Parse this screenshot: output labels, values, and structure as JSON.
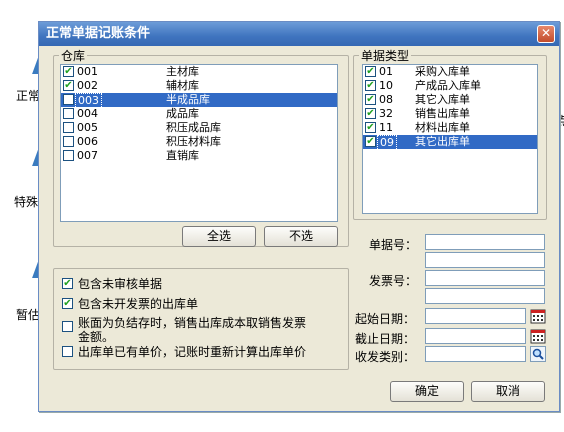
{
  "background": {
    "text1": "正常",
    "text2": "特殊",
    "text3": "暂估",
    "text4": "点"
  },
  "dialog": {
    "title": "正常单据记账条件",
    "close_glyph": "✕"
  },
  "warehouse": {
    "group_title": "仓库",
    "items": [
      {
        "code": "001",
        "name": "主材库",
        "checked": true,
        "selected": false
      },
      {
        "code": "002",
        "name": "辅材库",
        "checked": true,
        "selected": false
      },
      {
        "code": "003",
        "name": "半成品库",
        "checked": false,
        "selected": true
      },
      {
        "code": "004",
        "name": "成品库",
        "checked": false,
        "selected": false
      },
      {
        "code": "005",
        "name": "积压成品库",
        "checked": false,
        "selected": false
      },
      {
        "code": "006",
        "name": "积压材料库",
        "checked": false,
        "selected": false
      },
      {
        "code": "007",
        "name": "直销库",
        "checked": false,
        "selected": false
      }
    ],
    "select_all": "全选",
    "deselect_all": "不选"
  },
  "doc_types": {
    "group_title": "单据类型",
    "items": [
      {
        "code": "01",
        "name": "采购入库单",
        "checked": true,
        "selected": false
      },
      {
        "code": "10",
        "name": "产成品入库单",
        "checked": true,
        "selected": false
      },
      {
        "code": "08",
        "name": "其它入库单",
        "checked": true,
        "selected": false
      },
      {
        "code": "32",
        "name": "销售出库单",
        "checked": true,
        "selected": false
      },
      {
        "code": "11",
        "name": "材料出库单",
        "checked": true,
        "selected": false
      },
      {
        "code": "09",
        "name": "其它出库单",
        "checked": true,
        "selected": true
      }
    ]
  },
  "fields": {
    "doc_no_label": "单据号：",
    "invoice_no_label": "发票号：",
    "start_date_label": "起始日期：",
    "end_date_label": "截止日期：",
    "dispatch_label": "收发类别：",
    "doc_no_from": "",
    "doc_no_to": "",
    "invoice_no_from": "",
    "invoice_no_to": "",
    "start_date": "",
    "end_date": "",
    "dispatch": ""
  },
  "options": [
    {
      "label": "包含未审核单据",
      "checked": true
    },
    {
      "label": "包含未开发票的出库单",
      "checked": true
    },
    {
      "label": "账面为负结存时，销售出库成本取销售发票",
      "label2": "金额。",
      "checked": false
    },
    {
      "label": "出库单已有单价，记账时重新计算出库单价",
      "checked": false
    }
  ],
  "buttons": {
    "ok": "确定",
    "cancel": "取消"
  },
  "colors": {
    "title_bar": "#3f74bf",
    "selection": "#316ac5",
    "dialog_bg": "#ece9d8"
  }
}
